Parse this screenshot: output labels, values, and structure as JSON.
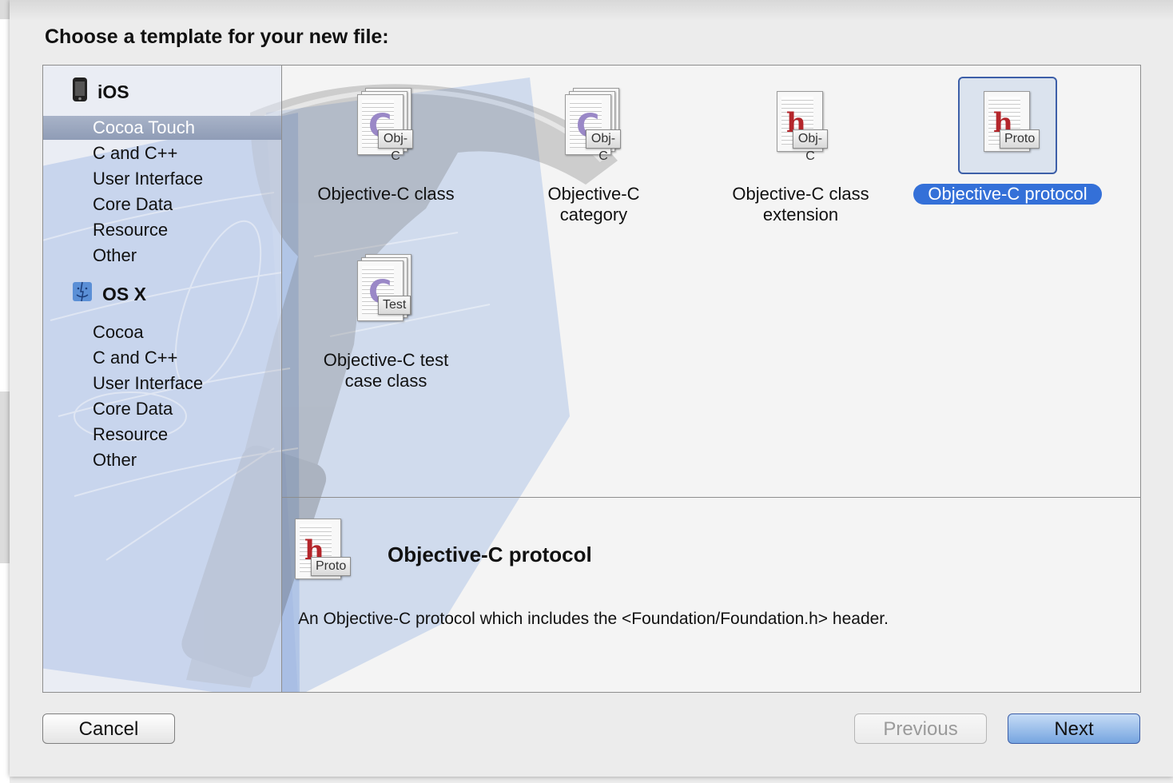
{
  "dialog": {
    "title": "Choose a template for your new file:"
  },
  "sidebar": {
    "groups": [
      {
        "name": "iOS",
        "icon": "iphone-icon",
        "items": [
          {
            "label": "Cocoa Touch",
            "selected": true
          },
          {
            "label": "C and C++"
          },
          {
            "label": "User Interface"
          },
          {
            "label": "Core Data"
          },
          {
            "label": "Resource"
          },
          {
            "label": "Other"
          }
        ]
      },
      {
        "name": "OS X",
        "icon": "finder-icon",
        "items": [
          {
            "label": "Cocoa"
          },
          {
            "label": "C and C++"
          },
          {
            "label": "User Interface"
          },
          {
            "label": "Core Data"
          },
          {
            "label": "Resource"
          },
          {
            "label": "Other"
          }
        ]
      }
    ]
  },
  "templates": [
    {
      "label": "Objective-C class",
      "tag": "Obj-C",
      "glyph": "C",
      "icon": "objc-class-file-icon"
    },
    {
      "label": "Objective-C category",
      "tag": "Obj-C",
      "glyph": "C",
      "icon": "objc-category-file-icon"
    },
    {
      "label": "Objective-C class extension",
      "tag": "Obj-C",
      "glyph": "h",
      "icon": "objc-extension-file-icon"
    },
    {
      "label": "Objective-C protocol",
      "tag": "Proto",
      "glyph": "h",
      "icon": "objc-protocol-file-icon",
      "selected": true
    },
    {
      "label": "Objective-C test case class",
      "tag": "Test",
      "glyph": "C",
      "icon": "objc-test-file-icon"
    }
  ],
  "description": {
    "title": "Objective-C protocol",
    "tag": "Proto",
    "glyph": "h",
    "text": "An Objective-C protocol which includes the <Foundation/Foundation.h> header."
  },
  "buttons": {
    "cancel": "Cancel",
    "previous": "Previous",
    "next": "Next"
  },
  "colors": {
    "selection": "#3470d8",
    "sidebar_selection": "#8f9cb6",
    "default_button": "#76a5e0"
  }
}
